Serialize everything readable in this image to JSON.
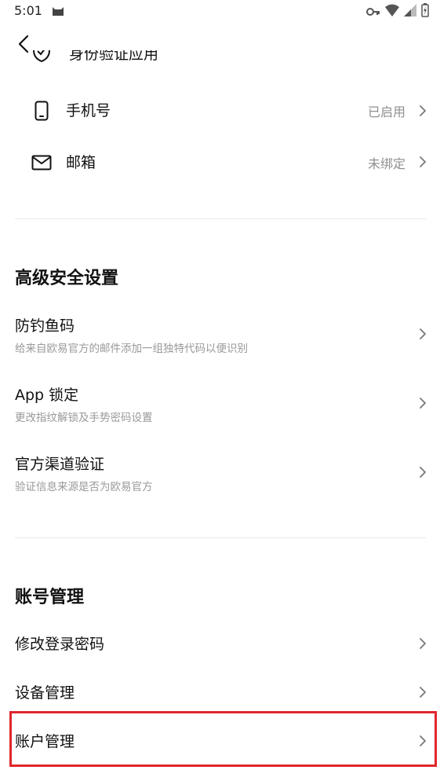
{
  "status_bar": {
    "time": "5:01"
  },
  "partial_row": {
    "label": "身份验证应用"
  },
  "contact": [
    {
      "label": "手机号",
      "value": "已启用"
    },
    {
      "label": "邮箱",
      "value": "未绑定"
    }
  ],
  "advanced": {
    "title": "高级安全设置",
    "items": [
      {
        "title": "防钓鱼码",
        "desc": "给来自欧易官方的邮件添加一组独特代码以便识别"
      },
      {
        "title": "App 锁定",
        "desc": "更改指纹解锁及手势密码设置"
      },
      {
        "title": "官方渠道验证",
        "desc": "验证信息来源是否为欧易官方"
      }
    ]
  },
  "account": {
    "title": "账号管理",
    "items": [
      {
        "title": "修改登录密码"
      },
      {
        "title": "设备管理"
      },
      {
        "title": "账户管理"
      }
    ]
  },
  "colors": {
    "highlight": "#e0262b",
    "muted_text": "#8f8f8f",
    "divider": "#e8e8e8"
  }
}
